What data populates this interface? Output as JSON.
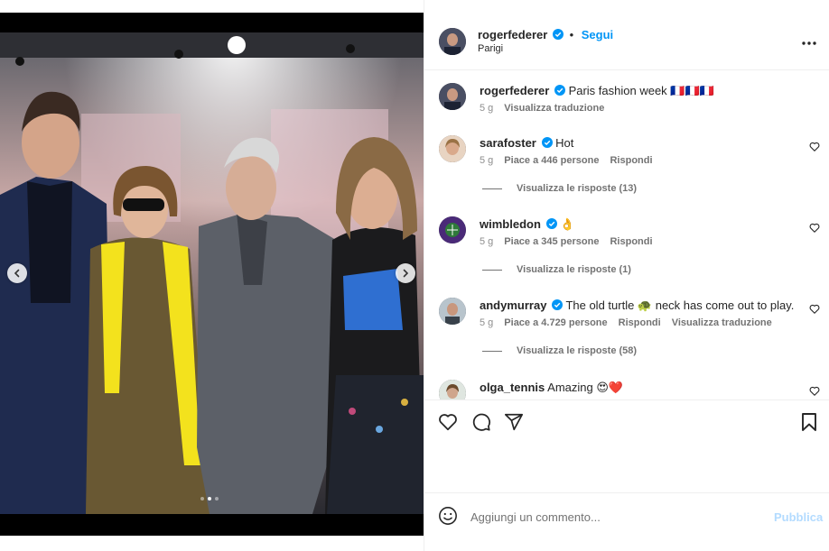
{
  "post": {
    "author": "rogerfederer",
    "follow_label": "Segui",
    "separator": "•",
    "location": "Parigi",
    "caption": "Paris fashion week 🇫🇷🇫🇷🇫🇷",
    "caption_age": "5 g",
    "translate_label": "Visualizza traduzione"
  },
  "media": {
    "carousel_total": 3,
    "carousel_active": 2
  },
  "comments": [
    {
      "user": "sarafoster",
      "verified": true,
      "text": "Hot",
      "age": "5 g",
      "likes": "Piace a 446 persone",
      "reply": "Rispondi",
      "translate": "",
      "replies": "Visualizza le risposte (13)"
    },
    {
      "user": "wimbledon",
      "verified": true,
      "text": "👌",
      "age": "5 g",
      "likes": "Piace a 345 persone",
      "reply": "Rispondi",
      "translate": "",
      "replies": "Visualizza le risposte (1)"
    },
    {
      "user": "andymurray",
      "verified": true,
      "text": "The old turtle 🐢 neck has come out to play.",
      "age": "5 g",
      "likes": "Piace a 4.729 persone",
      "reply": "Rispondi",
      "translate": "Visualizza traduzione",
      "replies": "Visualizza le risposte (58)"
    },
    {
      "user": "olga_tennis",
      "verified": false,
      "text": "Amazing 😍❤️",
      "age": "",
      "likes": "",
      "reply": "",
      "translate": "",
      "replies": ""
    }
  ],
  "composer": {
    "placeholder": "Aggiungi un commento...",
    "publish_label": "Pubblica"
  },
  "colors": {
    "accent": "#0095f6",
    "verified": "#0095f6",
    "publish_disabled": "#b3dbff",
    "muted": "#737373"
  },
  "icons": [
    "more-icon",
    "heart-icon",
    "comment-icon",
    "share-icon",
    "bookmark-icon",
    "emoji-icon",
    "verified-icon",
    "chevron-left-icon",
    "chevron-right-icon"
  ]
}
